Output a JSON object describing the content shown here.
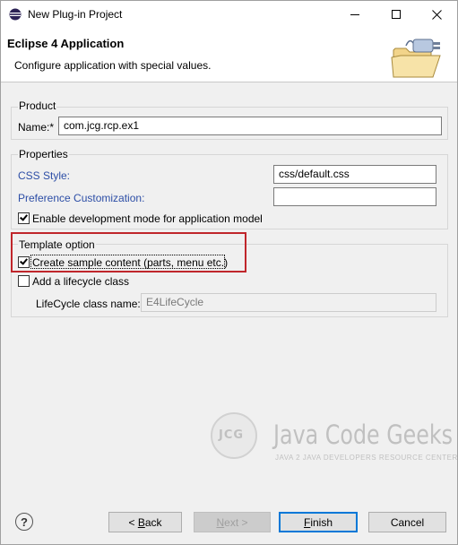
{
  "window": {
    "title": "New Plug-in Project"
  },
  "header": {
    "title": "Eclipse 4 Application",
    "description": "Configure application with special values."
  },
  "product": {
    "group_label": "Product",
    "name_label": "Name:*",
    "name_value": "com.jcg.rcp.ex1"
  },
  "properties": {
    "group_label": "Properties",
    "css_style_label": "CSS Style:",
    "css_style_value": "css/default.css",
    "pref_custom_label": "Preference Customization:",
    "pref_custom_value": "",
    "dev_mode_label": "Enable development mode for application model",
    "dev_mode_checked": true
  },
  "template": {
    "group_label": "Template option",
    "sample_content_label": "Create sample content (parts, menu etc.)",
    "sample_content_checked": true,
    "lifecycle_label": "Add a lifecycle class",
    "lifecycle_checked": false,
    "lifecycle_class_label": "LifeCycle class name:",
    "lifecycle_class_value": "E4LifeCycle"
  },
  "watermark": {
    "logo_text": "JCG",
    "brand": "Java Code Geeks",
    "tagline": "JAVA 2 JAVA DEVELOPERS RESOURCE CENTER"
  },
  "footer": {
    "help_glyph": "?",
    "back_pre": "< ",
    "back_key": "B",
    "back_rest": "ack",
    "next_key": "N",
    "next_rest": "ext >",
    "finish_key": "F",
    "finish_rest": "inish",
    "cancel_label": "Cancel"
  },
  "colors": {
    "link": "#2d4ea6",
    "highlight": "#c0262b",
    "default_button_border": "#0078d7"
  },
  "icons": {
    "app": "eclipse-icon",
    "minimize": "minimize-icon",
    "maximize": "maximize-icon",
    "close": "close-icon",
    "wizard": "plugin-folder-icon",
    "help": "help-icon"
  }
}
